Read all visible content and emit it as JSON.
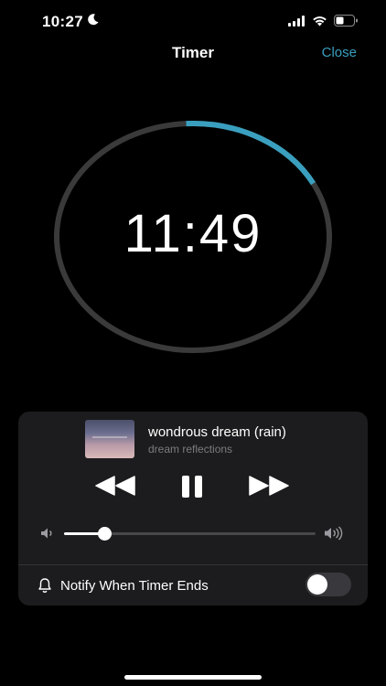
{
  "status_bar": {
    "time": "10:27",
    "icons": [
      "moon-icon",
      "cellular-signal-icon",
      "wifi-icon",
      "battery-icon"
    ]
  },
  "header": {
    "title": "Timer",
    "close_label": "Close"
  },
  "timer": {
    "remaining": "11:49",
    "progress_fraction": 0.18,
    "colors": {
      "progress": "#3a9fbf",
      "track": "#3a3a3a"
    }
  },
  "player": {
    "track_title": "wondrous dream (rain)",
    "track_artist": "dream reflections",
    "controls": [
      "rewind-icon",
      "pause-icon",
      "fast-forward-icon"
    ],
    "volume_fraction": 0.16,
    "volume_icons": [
      "volume-low-icon",
      "volume-high-icon"
    ]
  },
  "notify": {
    "label": "Notify When Timer Ends",
    "enabled": false
  },
  "colors": {
    "background": "#000000",
    "card": "#1c1c1e",
    "accent": "#3a9fbf"
  }
}
